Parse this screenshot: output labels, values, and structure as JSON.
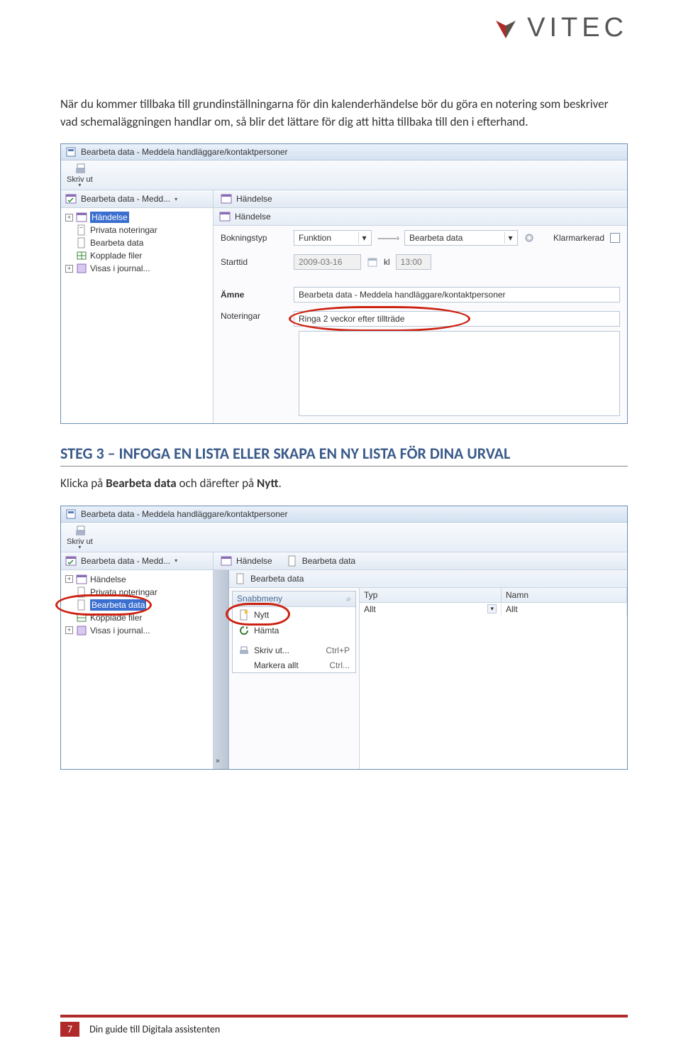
{
  "logo": {
    "text": "VITEC"
  },
  "para1": "När du kommer tillbaka till grundinställningarna för din kalenderhändelse bör du göra en notering som beskriver vad schemaläggningen handlar om, så blir det lättare för dig att hitta tillbaka till den i efterhand.",
  "screenshot1": {
    "title": "Bearbeta data - Meddela handläggare/kontaktpersoner",
    "print": "Skriv ut",
    "tree_tab": "Bearbeta data - Medd...",
    "tree": {
      "handelse": "Händelse",
      "privata": "Privata noteringar",
      "bearbeta": "Bearbeta data",
      "kopplade": "Kopplade filer",
      "visas": "Visas i journal..."
    },
    "content_tab": "Händelse",
    "pane_header": "Händelse",
    "form": {
      "bokningstyp_label": "Bokningstyp",
      "bokningstyp_value": "Funktion",
      "arrow": "---------›",
      "target_value": "Bearbeta data",
      "klarmarkerad": "Klarmarkerad",
      "starttid_label": "Starttid",
      "starttid_date": "2009-03-16",
      "kl": "kl",
      "starttid_time": "13:00",
      "amne_label": "Ämne",
      "amne_value": "Bearbeta data - Meddela handläggare/kontaktpersoner",
      "noteringar_label": "Noteringar",
      "noteringar_value": "Ringa 2 veckor efter tillträde"
    }
  },
  "step3_heading": "STEG 3 – INFOGA EN LISTA ELLER SKAPA EN NY LISTA FÖR DINA URVAL",
  "step3_text_a": "Klicka på ",
  "step3_text_b": "Bearbeta data",
  "step3_text_c": " och därefter på ",
  "step3_text_d": "Nytt",
  "step3_text_e": ".",
  "screenshot2": {
    "title": "Bearbeta data - Meddela handläggare/kontaktpersoner",
    "print": "Skriv ut",
    "tree_tab": "Bearbeta data - Medd...",
    "tree": {
      "handelse": "Händelse",
      "privata": "Privata noteringar",
      "bearbeta": "Bearbeta data",
      "kopplade": "Kopplade filer",
      "visas": "Visas i journal..."
    },
    "tab_handelse": "Händelse",
    "tab_bearbeta": "Bearbeta data",
    "pane_header": "Bearbeta data",
    "menu": {
      "header": "Snabbmeny",
      "search_icon": "⌕",
      "nytt": "Nytt",
      "hamta": "Hämta",
      "skriv": "Skriv ut...",
      "skriv_sc": "Ctrl+P",
      "markera": "Markera allt",
      "markera_sc": "Ctrl..."
    },
    "cols": {
      "typ": "Typ",
      "namn": "Namn"
    },
    "row": {
      "typ": "Allt",
      "namn": "Allt"
    }
  },
  "footer": {
    "page": "7",
    "text": "Din guide till Digitala assistenten"
  }
}
